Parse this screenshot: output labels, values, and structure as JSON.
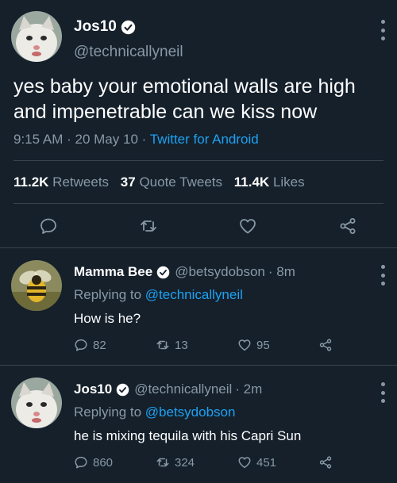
{
  "main_tweet": {
    "display_name": "Jos10",
    "handle": "@technicallyneil",
    "text": "yes baby your emotional walls are high and impenetrable can we kiss now",
    "time": "9:15 AM",
    "dot1": "·",
    "date": "20 May 10",
    "dot2": "·",
    "source": "Twitter for Android",
    "stats": {
      "retweets_count": "11.2K",
      "retweets_label": "Retweets",
      "quote_count": "37",
      "quote_label": "Quote Tweets",
      "likes_count": "11.4K",
      "likes_label": "Likes"
    }
  },
  "replies": [
    {
      "display_name": "Mamma Bee",
      "handle": "@betsydobson",
      "time": "· 8m",
      "replying_prefix": "Replying to",
      "replying_to": "@technicallyneil",
      "text": "How is he?",
      "reply_count": "82",
      "retweet_count": "13",
      "like_count": "95"
    },
    {
      "display_name": "Jos10",
      "handle": "@technicallyneil",
      "time": "· 2m",
      "replying_prefix": "Replying to",
      "replying_to": "@betsydobson",
      "text": "he is mixing tequila with his Capri Sun",
      "reply_count": "860",
      "retweet_count": "324",
      "like_count": "451"
    }
  ],
  "colors": {
    "background": "#15202b",
    "text_primary": "#ffffff",
    "text_secondary": "#8899a6",
    "link": "#1da1f2",
    "divider": "#38444d"
  },
  "icons": {
    "reply": "reply-icon",
    "retweet": "retweet-icon",
    "like": "heart-icon",
    "share": "share-icon",
    "verified": "verified-badge-icon",
    "more": "more-options-icon"
  }
}
